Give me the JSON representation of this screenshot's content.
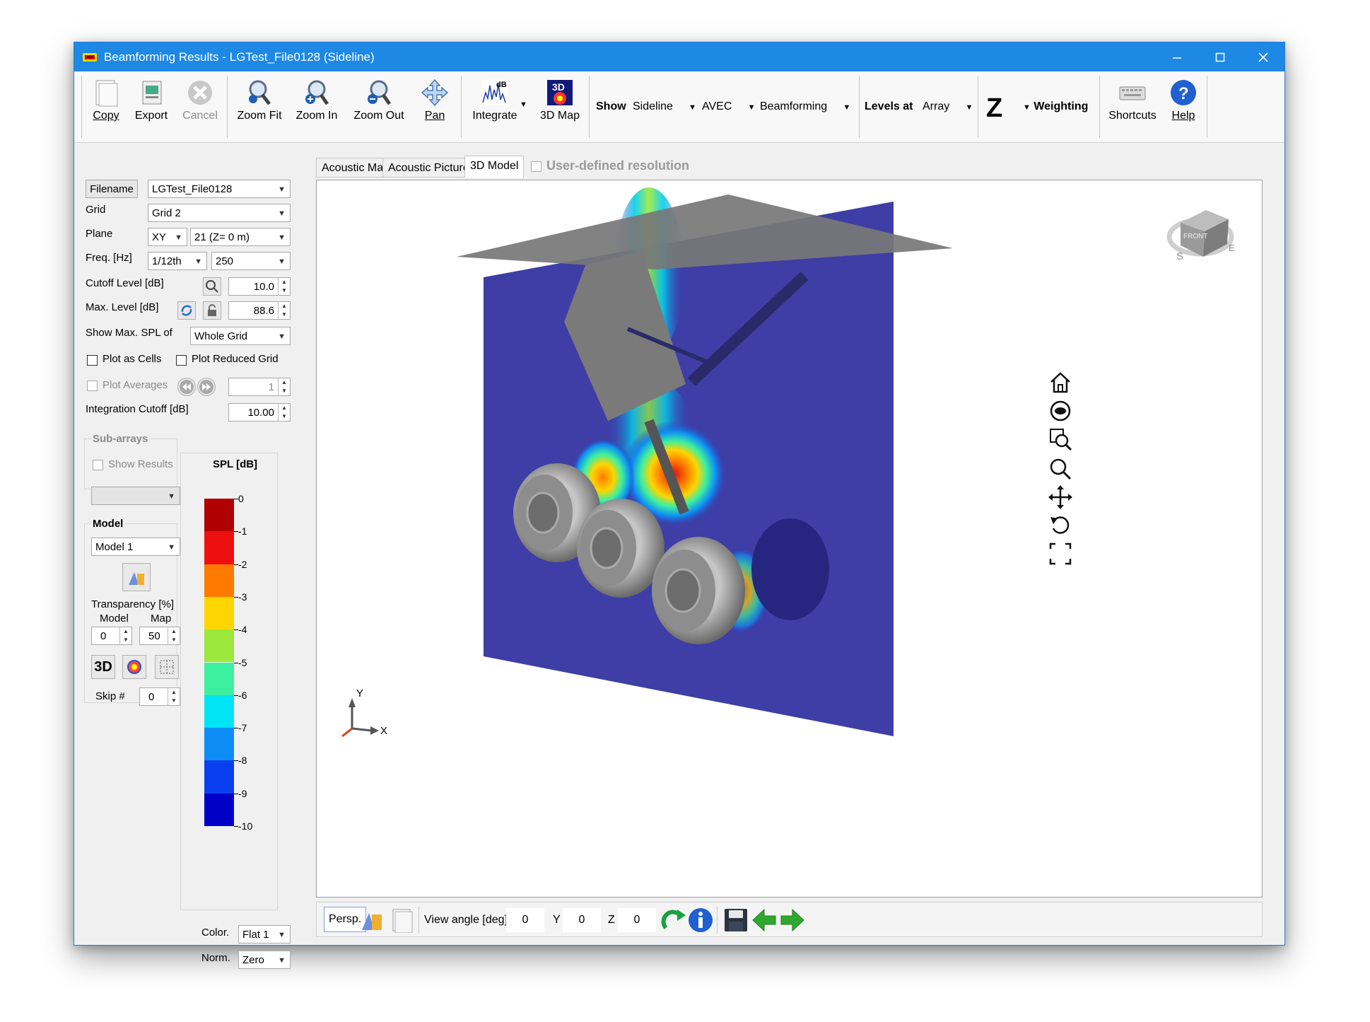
{
  "window": {
    "title": "Beamforming Results - LGTest_File0128 (Sideline)",
    "controls": [
      "minimize",
      "maximize",
      "close"
    ],
    "accent": "#1e88e5"
  },
  "toolbar": {
    "copy": "Copy",
    "export": "Export",
    "cancel": "Cancel",
    "zoom_fit": "Zoom Fit",
    "zoom_in": "Zoom In",
    "zoom_out": "Zoom Out",
    "pan": "Pan",
    "integrate": "Integrate",
    "map3d": "3D Map",
    "integrate_icon_text": "dB",
    "map3d_icon_text": "3D",
    "show_label": "Show",
    "show_value": "Sideline",
    "avec_value": "AVEC",
    "method_value": "Beamforming",
    "levels_label": "Levels at",
    "levels_value": "Array",
    "weighting_letter": "Z",
    "weighting_label": "Weighting",
    "shortcuts": "Shortcuts",
    "help": "Help"
  },
  "left": {
    "filename_label": "Filename",
    "filename_value": "LGTest_File0128",
    "grid_label": "Grid",
    "grid_value": "Grid 2",
    "plane_label": "Plane",
    "plane_axis": "XY",
    "plane_value": "21 (Z= 0 m)",
    "freq_label": "Freq. [Hz]",
    "freq_band": "1/12th",
    "freq_value": "250",
    "cutoff_label": "Cutoff Level [dB]",
    "cutoff_value": "10.0",
    "maxlevel_label": "Max. Level [dB]",
    "maxlevel_value": "88.6",
    "showmax_label": "Show Max. SPL of",
    "showmax_value": "Whole Grid",
    "plot_cells": "Plot as Cells",
    "plot_reduced": "Plot Reduced Grid",
    "plot_averages": "Plot Averages",
    "averages_value": "1",
    "integration_label": "Integration Cutoff [dB]",
    "integration_value": "10.00",
    "subarrays_title": "Sub-arrays",
    "show_results": "Show Results",
    "model_title": "Model",
    "model_value": "Model 1",
    "transparency_label": "Transparency [%]",
    "model_col": "Model",
    "map_col": "Map",
    "model_transp": "0",
    "map_transp": "50",
    "btn_3d": "3D",
    "skip_label": "Skip #",
    "skip_value": "0",
    "color_label": "Color.",
    "color_value": "Flat 1",
    "norm_label": "Norm.",
    "norm_value": "Zero"
  },
  "colorbar": {
    "title": "SPL [dB]",
    "ticks": [
      "0",
      "-1",
      "-2",
      "-3",
      "-4",
      "-5",
      "-6",
      "-7",
      "-8",
      "-9",
      "-10"
    ],
    "colors": [
      "#b00000",
      "#ee1010",
      "#ff7a00",
      "#ffd500",
      "#9be83a",
      "#3cf0a0",
      "#00e4f4",
      "#0d8cf5",
      "#0a3ff0",
      "#0000c8"
    ]
  },
  "tabs": [
    "Acoustic Map",
    "Acoustic Picture",
    "3D Model"
  ],
  "active_tab": "3D Model",
  "user_defined": "User-defined resolution",
  "axes": {
    "x": "X",
    "y": "Y"
  },
  "nav_cube": {
    "face": "FRONT",
    "south": "S",
    "east": "E"
  },
  "view_icons": [
    "home-icon",
    "orbit-icon",
    "zoom-window-icon",
    "zoom-icon",
    "pan-icon",
    "rotate-icon",
    "fullscreen-icon"
  ],
  "bottom": {
    "persp": "Persp.",
    "view_angle_label": "View angle [deg]: X",
    "x_value": "0",
    "y_label": "Y",
    "y_value": "0",
    "z_label": "Z",
    "z_value": "0"
  }
}
